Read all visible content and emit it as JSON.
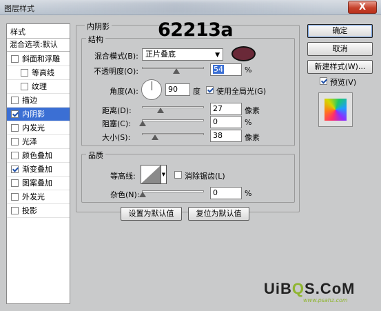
{
  "window": {
    "title": "图层样式",
    "close_label": "X"
  },
  "left_list": {
    "header": "样式",
    "sub_header": "混合选项:默认",
    "items": [
      {
        "label": "斜面和浮雕",
        "checked": false,
        "indent": false,
        "selected": false
      },
      {
        "label": "等高线",
        "checked": false,
        "indent": true,
        "selected": false
      },
      {
        "label": "纹理",
        "checked": false,
        "indent": true,
        "selected": false
      },
      {
        "label": "描边",
        "checked": false,
        "indent": false,
        "selected": false
      },
      {
        "label": "内阴影",
        "checked": true,
        "indent": false,
        "selected": true
      },
      {
        "label": "内发光",
        "checked": false,
        "indent": false,
        "selected": false
      },
      {
        "label": "光泽",
        "checked": false,
        "indent": false,
        "selected": false
      },
      {
        "label": "颜色叠加",
        "checked": false,
        "indent": false,
        "selected": false
      },
      {
        "label": "渐变叠加",
        "checked": true,
        "indent": false,
        "selected": false
      },
      {
        "label": "图案叠加",
        "checked": false,
        "indent": false,
        "selected": false
      },
      {
        "label": "外发光",
        "checked": false,
        "indent": false,
        "selected": false
      },
      {
        "label": "投影",
        "checked": false,
        "indent": false,
        "selected": false
      }
    ]
  },
  "panel": {
    "title": "内阴影",
    "structure": {
      "legend": "结构",
      "blend_mode_label": "混合模式(B):",
      "blend_mode_value": "正片叠底",
      "color_code": "62213a",
      "color_hex": "#6a2938",
      "opacity_label": "不透明度(O):",
      "opacity_value": "54",
      "opacity_unit": "%",
      "angle_label": "角度(A):",
      "angle_value": "90",
      "angle_unit": "度",
      "global_light_label": "使用全局光(G)",
      "global_light_checked": true,
      "distance_label": "距离(D):",
      "distance_value": "27",
      "distance_unit": "像素",
      "choke_label": "阻塞(C):",
      "choke_value": "0",
      "choke_unit": "%",
      "size_label": "大小(S):",
      "size_value": "38",
      "size_unit": "像素"
    },
    "quality": {
      "legend": "品质",
      "contour_label": "等高线:",
      "antialias_label": "消除锯齿(L)",
      "antialias_checked": false,
      "noise_label": "杂色(N):",
      "noise_value": "0",
      "noise_unit": "%"
    },
    "buttons": {
      "make_default": "设置为默认值",
      "reset_default": "复位为默认值"
    }
  },
  "right": {
    "ok_label": "确定",
    "cancel_label": "取消",
    "new_style_label": "新建样式(W)...",
    "preview_label": "预览(V)",
    "preview_checked": true
  },
  "watermark": {
    "brand_a": "UiB",
    "brand_o": "Q",
    "brand_b": "S.CoM",
    "sub": "www.psahz.com"
  }
}
